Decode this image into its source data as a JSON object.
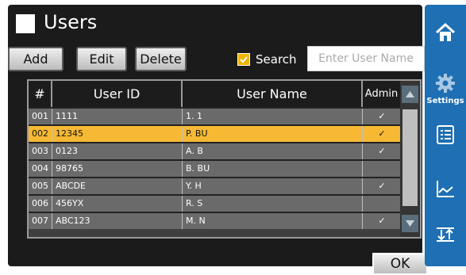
{
  "header": {
    "title": "Users"
  },
  "toolbar": {
    "add_label": "Add",
    "edit_label": "Edit",
    "delete_label": "Delete"
  },
  "search": {
    "label": "Search",
    "checked": true,
    "placeholder": "Enter User Name"
  },
  "table": {
    "columns": [
      "#",
      "User ID",
      "User Name",
      "Admin"
    ],
    "rows": [
      {
        "num": "001",
        "user_id": "1111",
        "user_name": "1. 1",
        "admin": "✓"
      },
      {
        "num": "002",
        "user_id": "12345",
        "user_name": "P. BU",
        "admin": "✓",
        "selected": true
      },
      {
        "num": "003",
        "user_id": "0123",
        "user_name": "A. B",
        "admin": "✓"
      },
      {
        "num": "004",
        "user_id": "98765",
        "user_name": "B. BU",
        "admin": ""
      },
      {
        "num": "005",
        "user_id": "ABCDE",
        "user_name": "Y. H",
        "admin": "✓"
      },
      {
        "num": "006",
        "user_id": "456YX",
        "user_name": "R. S",
        "admin": ""
      },
      {
        "num": "007",
        "user_id": "ABC123",
        "user_name": "M. N",
        "admin": "✓"
      }
    ]
  },
  "footer": {
    "ok_label": "OK"
  },
  "sidebar": {
    "home_icon": "home-icon",
    "settings_label": "Settings",
    "settings_icon": "gear-icon",
    "list_icon": "list-icon",
    "chart_icon": "chart-icon",
    "transfer_icon": "transfer-icon"
  },
  "colors": {
    "accent": "#1e6fb3",
    "selected_row": "#f7b933",
    "check": "#f0b400"
  }
}
